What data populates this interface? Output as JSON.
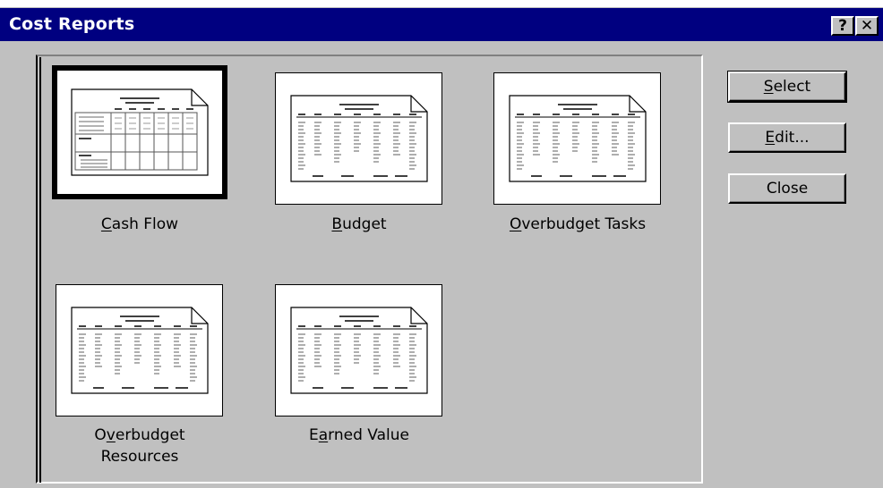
{
  "window": {
    "title": "Cost Reports",
    "help_label": "?",
    "close_label": "✕"
  },
  "reports": [
    {
      "pre": "",
      "key": "C",
      "post": "ash Flow",
      "line2": "",
      "thumb": "table-icon",
      "selected": true
    },
    {
      "pre": "",
      "key": "B",
      "post": "udget",
      "line2": "",
      "thumb": "columns-icon",
      "selected": false
    },
    {
      "pre": "",
      "key": "O",
      "post": "verbudget Tasks",
      "line2": "",
      "thumb": "columns-icon",
      "selected": false
    },
    {
      "pre": "O",
      "key": "v",
      "post": "erbudget",
      "line2": "Resources",
      "thumb": "columns-icon",
      "selected": false
    },
    {
      "pre": "E",
      "key": "a",
      "post": "rned Value",
      "line2": "",
      "thumb": "columns-icon",
      "selected": false
    }
  ],
  "buttons": {
    "select": {
      "pre": "",
      "key": "S",
      "post": "elect"
    },
    "edit": {
      "pre": "",
      "key": "E",
      "post": "dit..."
    },
    "close": {
      "pre": "",
      "key": "",
      "post": "Close"
    }
  }
}
